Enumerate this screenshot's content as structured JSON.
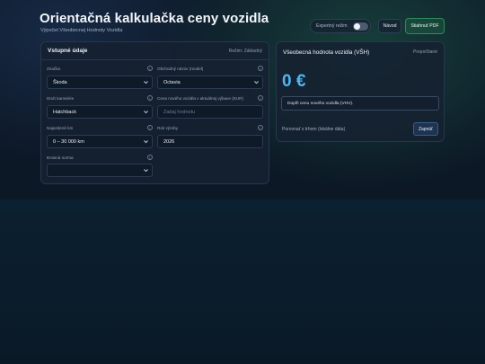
{
  "header": {
    "title": "Orientačná kalkulačka ceny vozidla",
    "subtitle": "Výpočet Všeobecnej Hodnoty Vozidla"
  },
  "toolbar": {
    "expert_label": "Expertný režim",
    "expert_on": false,
    "navod_label": "Návod",
    "pdf_label": "Stiahnuť PDF"
  },
  "inputs": {
    "title": "Vstupné údaje",
    "mode": "Režim: Základný",
    "fields": {
      "brand": {
        "label": "Značka",
        "value": "Škoda"
      },
      "model": {
        "label": "Obchodný názov (model)",
        "value": "Octavia"
      },
      "body": {
        "label": "Druh karosérie",
        "value": "Hatchback"
      },
      "new_price": {
        "label": "Cena nového vozidla v aktuálnej výbave (EUR)",
        "placeholder": "Zadaj hodnotu"
      },
      "mileage": {
        "label": "Najazdené km",
        "value": "0 – 30 000 km"
      },
      "year": {
        "label": "Rok výroby",
        "value": "2026"
      },
      "emission": {
        "label": "Emisná norma",
        "value": ""
      }
    },
    "info_glyph": "i"
  },
  "result": {
    "title": "Všeobecná hodnota vozidla (VŠH)",
    "status": "Prepočítané",
    "value": "0 €",
    "hint": "Doplň cenu nového vozidla (VHV).",
    "compare_label": "Porovnať s trhom (lokálne dáta)",
    "compare_button": "Zapnúť"
  },
  "colors": {
    "accent_value": "#4fb6f2",
    "pdf_button": "#2f8a5c"
  }
}
